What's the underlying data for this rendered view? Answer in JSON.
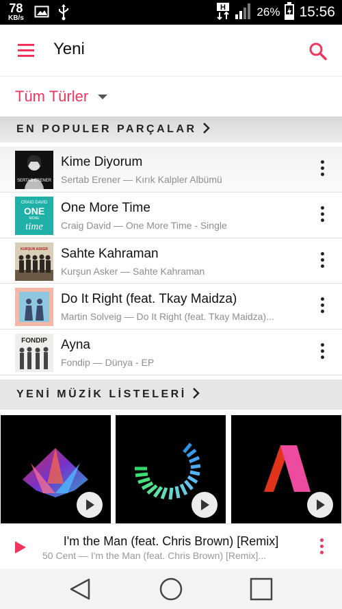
{
  "status_bar": {
    "speed_value": "78",
    "speed_unit": "KB/s",
    "battery": "26%",
    "time": "15:56",
    "icons": [
      "image-icon",
      "usb-icon",
      "h-network-icon",
      "signal-icon",
      "battery-charging-icon"
    ]
  },
  "toolbar": {
    "title": "Yeni",
    "menu_icon": "hamburger-menu-icon",
    "search_icon": "search-icon"
  },
  "genre_filter": {
    "label": "Tüm Türler"
  },
  "top_songs": {
    "header": "EN POPULER PARÇALAR",
    "items": [
      {
        "title": "Kime Diyorum",
        "subtitle": "Sertab Erener — Kırık Kalpler Albümü",
        "art_text": "SERTAB ERENER"
      },
      {
        "title": "One More Time",
        "subtitle": "Craig David — One More Time - Single",
        "art_text_top": "CRAIG DAVID",
        "art_text_main": "ONE",
        "art_text_sub": "MORE",
        "art_text_script": "time"
      },
      {
        "title": "Sahte Kahraman",
        "subtitle": "Kurşun Asker — Sahte Kahraman",
        "art_text": "KURŞUN ASKER"
      },
      {
        "title": "Do It Right (feat. Tkay Maidza)",
        "subtitle": "Martin Solveig — Do It Right (feat. Tkay Maidza)..."
      },
      {
        "title": "Ayna",
        "subtitle": "Fondip — Dünya - EP",
        "art_text": "FONDIP"
      }
    ]
  },
  "new_lists": {
    "header": "YENİ MÜZİK LİSTELERİ"
  },
  "now_playing": {
    "title": "I'm the Man (feat. Chris Brown) [Remix]",
    "subtitle": "50 Cent — I'm the Man (feat. Chris Brown) [Remix]..."
  },
  "colors": {
    "accent": "#f2345c",
    "section_bg": "#e6e6e6"
  }
}
